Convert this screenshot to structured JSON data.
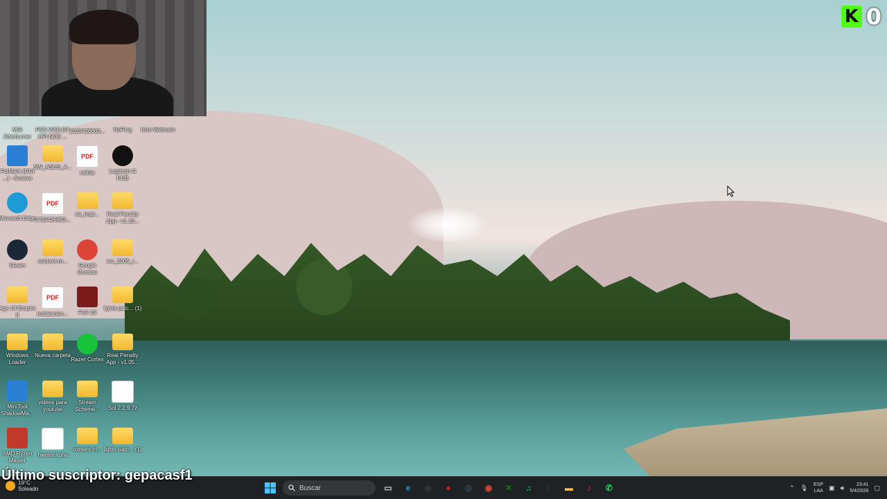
{
  "stream": {
    "logo_letter": "K",
    "viewer_count": "0",
    "subscriber_text": "Último suscriptor: gepacasf1"
  },
  "desktop_icons": [
    {
      "label": "MSI Afterburner",
      "icon": "msi-icon",
      "kind": "app",
      "color": "#b3131b"
    },
    {
      "label": "PES 2006 BY HPI NOE ...",
      "icon": "pes-icon",
      "kind": "app",
      "color": "#1c4f9c"
    },
    {
      "label": "2023426603...",
      "icon": "file-icon",
      "kind": "file",
      "color": "#ffffff"
    },
    {
      "label": "NoPing",
      "icon": "noping-icon",
      "kind": "app",
      "color": "#222222"
    },
    {
      "label": "Iriun Webcam",
      "icon": "webcam-icon",
      "kind": "app",
      "color": "#333333"
    },
    {
      "label": "FurMark (GUI ...) - Acceso di...",
      "icon": "furmark-icon",
      "kind": "app",
      "color": "#2a7fd4"
    },
    {
      "label": "SW_ASUS_A...",
      "icon": "folder-icon",
      "kind": "folder",
      "color": "#f2c040"
    },
    {
      "label": "salida",
      "icon": "pdf-icon",
      "kind": "pdf",
      "color": "#ffffff"
    },
    {
      "label": "Logitech G HUB",
      "icon": "logitech-icon",
      "kind": "circle",
      "color": "#111111"
    },
    {
      "label": "Microsoft Edge",
      "icon": "edge-icon",
      "kind": "circle",
      "color": "#1e9bd7"
    },
    {
      "label": "2723426803...",
      "icon": "pdf-icon",
      "kind": "pdf",
      "color": "#ffffff"
    },
    {
      "label": "as_impl...",
      "icon": "folder-icon",
      "kind": "folder",
      "color": "#f2c040"
    },
    {
      "label": "Real Penalty App - v1.10...",
      "icon": "folder-icon",
      "kind": "folder",
      "color": "#f2c040"
    },
    {
      "label": "Steam",
      "icon": "steam-icon",
      "kind": "circle",
      "color": "#1b2838"
    },
    {
      "label": "content-m...",
      "icon": "folder-icon",
      "kind": "folder",
      "color": "#f2c040"
    },
    {
      "label": "Google Chrome",
      "icon": "chrome-icon",
      "kind": "circle",
      "color": "#db4437"
    },
    {
      "label": "vrc_2005_r...",
      "icon": "folder-icon",
      "kind": "folder",
      "color": "#f2c040"
    },
    {
      "label": "Age Of Empire II",
      "icon": "folder-icon",
      "kind": "folder",
      "color": "#f2c040"
    },
    {
      "label": "instalacion...",
      "icon": "pdf-icon",
      "kind": "pdf",
      "color": "#ffffff"
    },
    {
      "label": "F1® 25",
      "icon": "f1-icon",
      "kind": "app",
      "color": "#7a1a1a"
    },
    {
      "label": "lights-patc... (1)",
      "icon": "folder-icon",
      "kind": "folder",
      "color": "#f2c040"
    },
    {
      "label": "Windows Loader",
      "icon": "folder-icon",
      "kind": "folder",
      "color": "#f2c040"
    },
    {
      "label": "Nueva carpeta",
      "icon": "folder-icon",
      "kind": "folder",
      "color": "#f2c040"
    },
    {
      "label": "Razer Cortex",
      "icon": "razer-icon",
      "kind": "circle",
      "color": "#18c23a"
    },
    {
      "label": "Real Penalty App - v1.05...",
      "icon": "folder-icon",
      "kind": "folder",
      "color": "#f2c040"
    },
    {
      "label": "MiniTool ShadowMa...",
      "icon": "minitool-icon",
      "kind": "app",
      "color": "#2a7fd4"
    },
    {
      "label": "videos para youtube",
      "icon": "folder-icon",
      "kind": "folder",
      "color": "#f2c040"
    },
    {
      "label": "Stream Scheme...",
      "icon": "folder-icon",
      "kind": "folder",
      "color": "#f2c040"
    },
    {
      "label": "Sol 2.2.9.7z",
      "icon": "file-icon",
      "kind": "file",
      "color": "#ffffff"
    },
    {
      "label": "AMD Ryzen Master",
      "icon": "ryzen-icon",
      "kind": "app",
      "color": "#c0392b"
    },
    {
      "label": "hwmonitorw",
      "icon": "gear-icon",
      "kind": "file",
      "color": "#ffffff"
    },
    {
      "label": "content-m...",
      "icon": "folder-icon",
      "kind": "folder",
      "color": "#f2c040"
    },
    {
      "label": "lights-patc... (1)",
      "icon": "folder-icon",
      "kind": "folder",
      "color": "#f2c040"
    }
  ],
  "taskbar": {
    "weather_temp": "19°C",
    "weather_desc": "Soleado",
    "search_placeholder": "Buscar",
    "apps": [
      {
        "name": "task-view-icon",
        "glyph": "▭",
        "color": "#cccccc"
      },
      {
        "name": "edge-icon",
        "glyph": "e",
        "color": "#1e9bd7"
      },
      {
        "name": "obs-icon",
        "glyph": "◉",
        "color": "#333333"
      },
      {
        "name": "record-icon",
        "glyph": "●",
        "color": "#cc1f1f"
      },
      {
        "name": "steam-icon",
        "glyph": "◎",
        "color": "#3a4a5a"
      },
      {
        "name": "chrome-icon",
        "glyph": "◉",
        "color": "#db4437"
      },
      {
        "name": "xbox-icon",
        "glyph": "✕",
        "color": "#107c10"
      },
      {
        "name": "spotify-icon",
        "glyph": "♫",
        "color": "#1db954"
      },
      {
        "name": "epic-icon",
        "glyph": "E",
        "color": "#2a2a2a"
      },
      {
        "name": "file-explorer-icon",
        "glyph": "▬",
        "color": "#f2c040"
      },
      {
        "name": "tiktok-icon",
        "glyph": "♪",
        "color": "#ee1d52"
      },
      {
        "name": "whatsapp-icon",
        "glyph": "✆",
        "color": "#25d366"
      }
    ],
    "lang_top": "ESP",
    "lang_bottom": "LAA",
    "time": "23:41",
    "date": "5/4/2026"
  }
}
